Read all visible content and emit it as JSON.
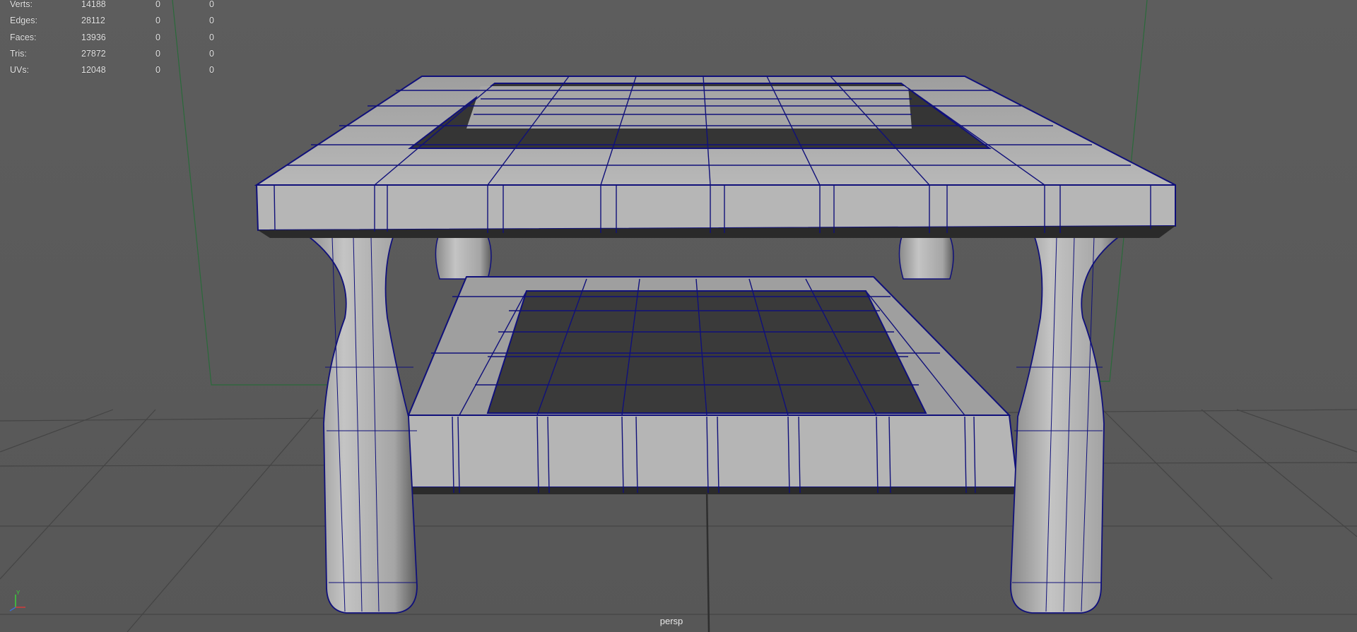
{
  "hud": {
    "rows": [
      {
        "label": "Verts:",
        "total": "14188",
        "selected": "0",
        "component": "0"
      },
      {
        "label": "Edges:",
        "total": "28112",
        "selected": "0",
        "component": "0"
      },
      {
        "label": "Faces:",
        "total": "13936",
        "selected": "0",
        "component": "0"
      },
      {
        "label": "Tris:",
        "total": "27872",
        "selected": "0",
        "component": "0"
      },
      {
        "label": "UVs:",
        "total": "12048",
        "selected": "0",
        "component": "0"
      }
    ]
  },
  "viewport": {
    "camera_name": "persp",
    "colors": {
      "background": "#5a5a5a",
      "grid": "#404040",
      "grid_axis": "#2f2f2f",
      "wireframe": "#10107a",
      "mesh_light": "#bdbdbd",
      "mesh_mid": "#a9a9a9",
      "mesh_dark": "#2b2b2b",
      "green_line": "#2a6a3a"
    }
  },
  "axis_gizmo": {
    "y_label": "Y",
    "colors": {
      "x": "#d23b3b",
      "y": "#3bd23b",
      "z": "#3b6ed2"
    }
  }
}
